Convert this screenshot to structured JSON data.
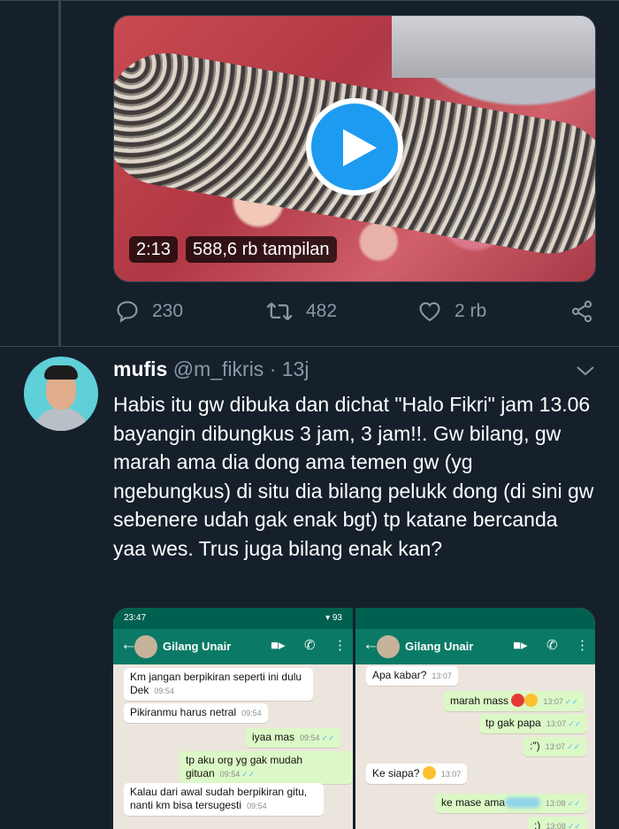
{
  "video": {
    "duration": "2:13",
    "views": "588,6 rb tampilan"
  },
  "actions": {
    "replies": "230",
    "retweets": "482",
    "likes": "2 rb"
  },
  "tweet": {
    "name": "mufis",
    "handle": "@m_fikris",
    "separator": "·",
    "age": "13j",
    "text": "Habis itu gw dibuka dan dichat \"Halo Fikri\" jam 13.06 bayangin dibungkus 3 jam, 3 jam!!. Gw bilang, gw marah ama dia dong ama temen gw (yg ngebungkus) di situ dia bilang pelukk dong (di sini gw sebenere udah gak enak bgt) tp katane bercanda yaa wes. Trus juga bilang enak kan?"
  },
  "screenshot_left": {
    "status_time": "23:47",
    "battery": "93",
    "contact": "Gilang Unair",
    "messages": [
      {
        "text": "Km jangan berpikiran seperti ini dulu Dek",
        "time": "09:54",
        "dir": "in"
      },
      {
        "text": "Pikiranmu harus netral",
        "time": "09:54",
        "dir": "in"
      },
      {
        "text": "iyaa mas",
        "time": "09:54",
        "dir": "out"
      },
      {
        "text": "tp aku org yg gak mudah gituan",
        "time": "09:54",
        "dir": "out"
      },
      {
        "text": "Kalau dari awal sudah berpikiran gitu, nanti km bisa tersugesti",
        "time": "09:54",
        "dir": "in"
      }
    ]
  },
  "screenshot_right": {
    "contact": "Gilang Unair",
    "messages": [
      {
        "text": "Apa kabar?",
        "time": "13:07",
        "dir": "in"
      },
      {
        "text": "marah mass",
        "time": "13:07",
        "dir": "out"
      },
      {
        "text": "tp gak papa",
        "time": "13:07",
        "dir": "out"
      },
      {
        "text": ":\")",
        "time": "13:07",
        "dir": "out"
      },
      {
        "text": "Ke siapa?",
        "time": "13:07",
        "dir": "in"
      },
      {
        "text": "ke mase ama",
        "time": "13:08",
        "dir": "out"
      },
      {
        "text": ":)",
        "time": "13:08",
        "dir": "out"
      }
    ]
  },
  "colors": {
    "background": "#15202b",
    "accent": "#1d9bf0",
    "muted": "#8899a6",
    "wa_header": "#0a7a66"
  },
  "icons": [
    "play-icon",
    "reply-icon",
    "retweet-icon",
    "like-icon",
    "share-icon",
    "chevron-down-icon",
    "back-arrow-icon",
    "video-call-icon",
    "phone-icon",
    "more-vertical-icon"
  ]
}
